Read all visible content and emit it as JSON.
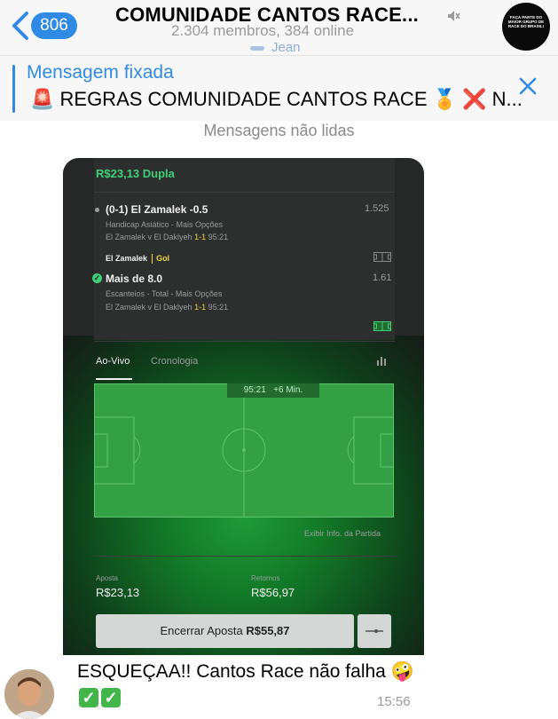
{
  "header": {
    "back_count": "806",
    "title": "COMUNIDADE CANTOS RACE...",
    "subtitle": "2.304 membros, 384 online",
    "typing": "Jean",
    "avatar_text": "FAÇA PARTE DO MAIOR GRUPO DE RACE DO BRASIL!"
  },
  "pinned": {
    "title": "Mensagem fixada",
    "text": "🚨 REGRAS COMUNIDADE CANTOS RACE 🏅 ❌ N..."
  },
  "chat": {
    "unread_label": "Mensagens não lidas"
  },
  "bet": {
    "header": "R$23,13 Dupla",
    "sel1": {
      "title": "(0-1) El Zamalek -0.5",
      "odds": "1.525",
      "market": "Handicap Asiático - Mais Opções",
      "match_teams": "El Zamalek v El Daklyeh",
      "score": "1-1",
      "clock": "95:21",
      "event_team": "El Zamalek",
      "event": "Gol"
    },
    "sel2": {
      "title": "Mais de 8.0",
      "odds": "1.61",
      "market": "Escanteios - Total - Mais Opções",
      "match_teams": "El Zamalek v El Daklyeh",
      "score": "1-1",
      "clock": "95:21"
    },
    "tabs": [
      "Ao-Vivo",
      "Cronologia"
    ],
    "timer": "95:21",
    "added_time": "+6 Min.",
    "match_info": "Exibir Info. da Partida",
    "stake_label": "Aposta",
    "stake": "R$23,13",
    "returns_label": "Retornos",
    "returns": "R$56,97",
    "cashout_label": "Encerrar Aposta",
    "cashout_value": "R$55,87"
  },
  "message": {
    "text": "ESQUEÇAA!! Cantos Race não falha 🤪",
    "time": "15:56"
  },
  "colors": {
    "accent": "#2f8ae5",
    "bet_green": "#3ed17a",
    "pitch": "#34a046",
    "check_green": "#43b649"
  }
}
